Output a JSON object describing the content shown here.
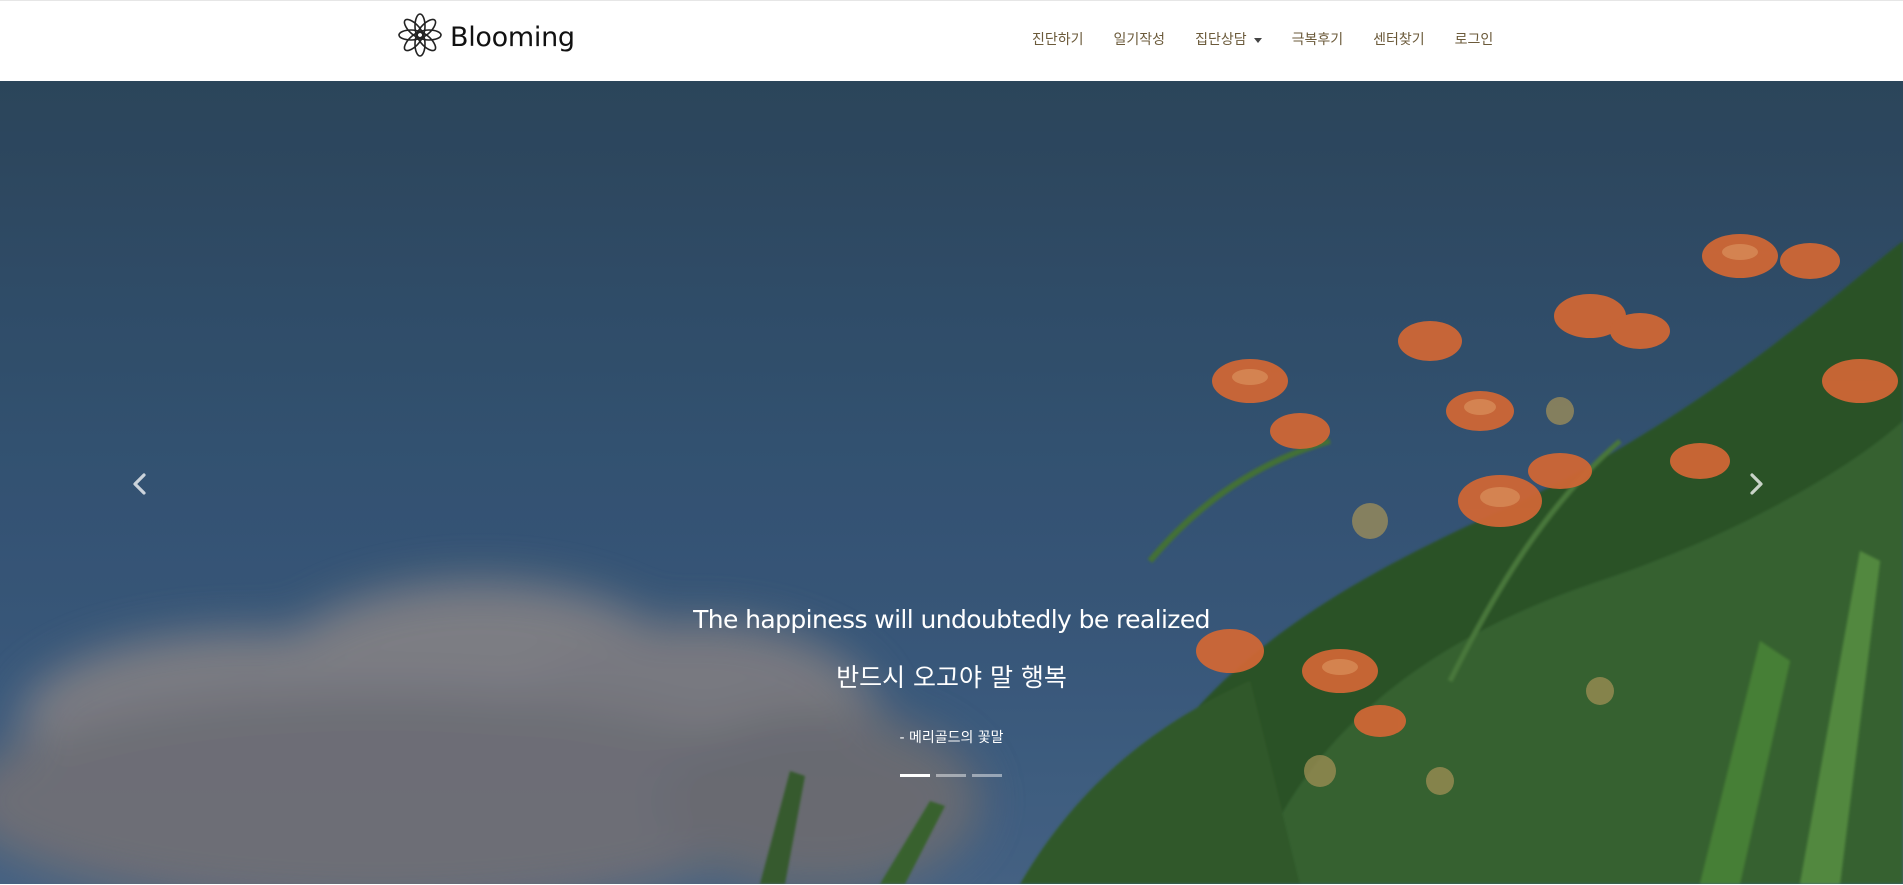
{
  "brand": {
    "name": "Blooming",
    "logo_icon": "flower-logo-icon"
  },
  "nav": {
    "items": [
      {
        "label": "진단하기"
      },
      {
        "label": "일기작성"
      },
      {
        "label": "집단상담",
        "has_dropdown": true
      },
      {
        "label": "극복후기"
      },
      {
        "label": "센터찾기"
      },
      {
        "label": "로그인"
      }
    ]
  },
  "carousel": {
    "title": "The happiness will undoubtedly be realized",
    "subtitle": "반드시 오고야 말 행복",
    "source": "- 메리골드의 꽃말",
    "prev_icon": "chevron-left-icon",
    "next_icon": "chevron-right-icon",
    "slide_count": 3,
    "active_index": 0
  },
  "colors": {
    "sky": "#37587a",
    "flower": "#e0703a",
    "foliage": "#3e6b3a",
    "nav_text": "#6b5a3a"
  }
}
